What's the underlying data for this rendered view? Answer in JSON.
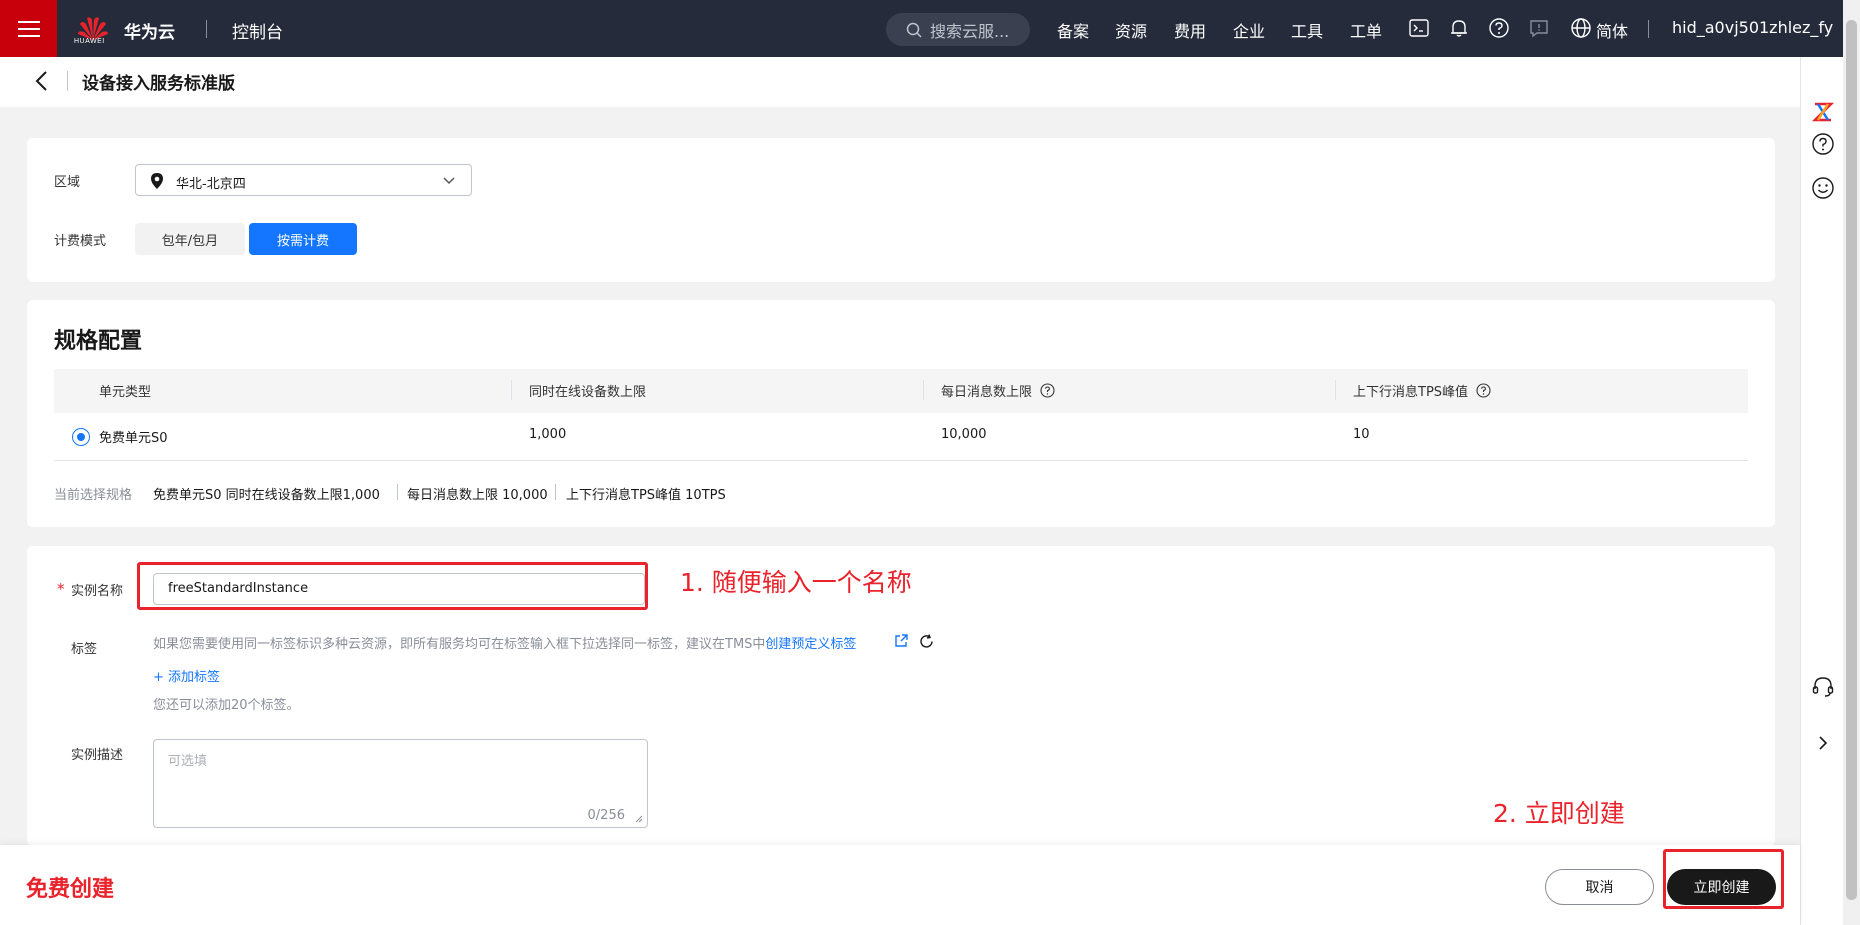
{
  "topbar": {
    "logo_text": "HUAWEI",
    "brand": "华为云",
    "console": "控制台",
    "search_placeholder": "搜索云服...",
    "nav": [
      "备案",
      "资源",
      "费用",
      "企业",
      "工具",
      "工单"
    ],
    "language": "简体",
    "user": "hid_a0vj501zhlez_fy"
  },
  "page": {
    "title": "设备接入服务标准版"
  },
  "region": {
    "label": "区域",
    "value": "华北-北京四"
  },
  "billing": {
    "label": "计费模式",
    "options": [
      "包年/包月",
      "按需计费"
    ],
    "selected": "按需计费"
  },
  "spec": {
    "title": "规格配置",
    "columns": [
      "单元类型",
      "同时在线设备数上限",
      "每日消息数上限",
      "上下行消息TPS峰值"
    ],
    "rows": [
      {
        "type": "免费单元S0",
        "online_limit": "1,000",
        "daily_msgs": "10,000",
        "tps": "10"
      }
    ],
    "summary_label": "当前选择规格",
    "summary_parts": [
      "免费单元S0  同时在线设备数上限1,000",
      "每日消息数上限 10,000",
      "上下行消息TPS峰值 10TPS"
    ]
  },
  "instance": {
    "name_label": "实例名称",
    "name_value": "freeStandardInstance",
    "name_required_mark": "*",
    "tag_label": "标签",
    "tag_hint": "如果您需要使用同一标签标识多种云资源，即所有服务均可在标签输入框下拉选择同一标签，建议在TMS中",
    "tag_link": "创建预定义标签",
    "add_tag": "+ 添加标签",
    "tag_count_hint": "您还可以添加20个标签。",
    "desc_label": "实例描述",
    "desc_placeholder": "可选填",
    "desc_counter": "0/256"
  },
  "annotations": {
    "step1": "1. 随便输入一个名称",
    "step2": "2. 立即创建"
  },
  "footer": {
    "free_create": "免费创建",
    "cancel": "取消",
    "create": "立即创建"
  },
  "colors": {
    "topbar_bg": "#252b3a",
    "accent_red": "#c7000b",
    "primary_blue": "#1476ff",
    "annotation_red": "#e8232b"
  }
}
